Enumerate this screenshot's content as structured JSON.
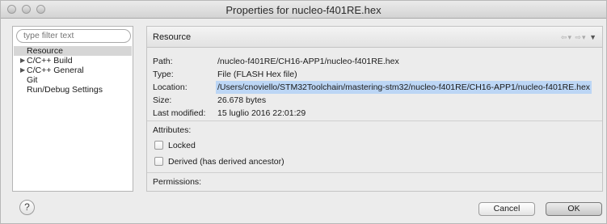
{
  "window": {
    "title": "Properties for nucleo-f401RE.hex"
  },
  "sidebar": {
    "filter_placeholder": "type filter text",
    "items": [
      {
        "label": "Resource",
        "expandable": false,
        "selected": true
      },
      {
        "label": "C/C++ Build",
        "expandable": true,
        "selected": false
      },
      {
        "label": "C/C++ General",
        "expandable": true,
        "selected": false
      },
      {
        "label": "Git",
        "expandable": false,
        "selected": false
      },
      {
        "label": "Run/Debug Settings",
        "expandable": false,
        "selected": false
      }
    ]
  },
  "page": {
    "title": "Resource",
    "nav_icons": [
      "back-arrow-icon",
      "forward-arrow-icon",
      "view-menu-icon"
    ],
    "properties": [
      {
        "label": "Path:",
        "value": "/nucleo-f401RE/CH16-APP1/nucleo-f401RE.hex"
      },
      {
        "label": "Type:",
        "value": "File  (FLASH Hex file)"
      },
      {
        "label": "Location:",
        "value": "/Users/cnoviello/STM32Toolchain/mastering-stm32/nucleo-f401RE/CH16-APP1/nucleo-f401RE.hex"
      },
      {
        "label": "Size:",
        "value": "26.678  bytes"
      },
      {
        "label": "Last modified:",
        "value": "15 luglio 2016 22:01:29"
      }
    ],
    "attributes_label": "Attributes:",
    "locked_label": "Locked",
    "locked_checked": false,
    "derived_label": "Derived (has derived ancestor)",
    "derived_checked": false,
    "permissions_label": "Permissions:"
  },
  "buttons": {
    "help": "?",
    "cancel": "Cancel",
    "ok": "OK"
  },
  "colors": {
    "selection_highlight": "#bcd6f5",
    "tree_selection": "#d6d6d6"
  }
}
